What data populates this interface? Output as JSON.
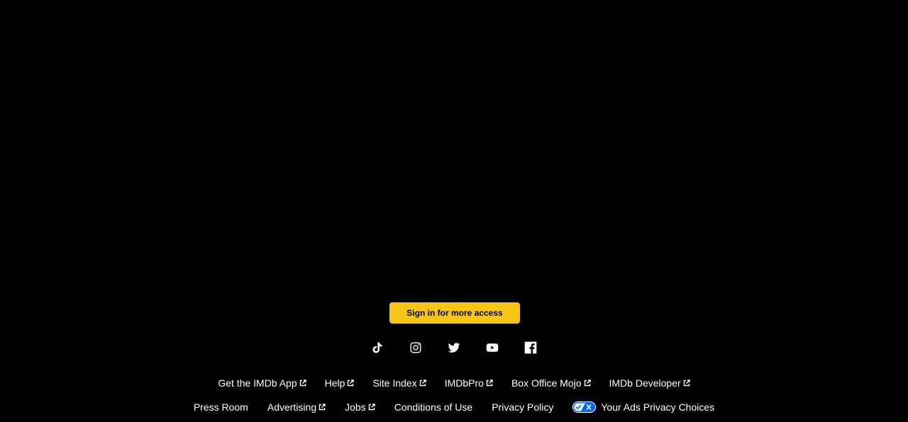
{
  "signin": {
    "label": "Sign in for more access"
  },
  "social": {
    "icons": [
      "tiktok-icon",
      "instagram-icon",
      "twitter-icon",
      "youtube-icon",
      "facebook-icon"
    ]
  },
  "footer": {
    "row1": [
      {
        "label": "Get the IMDb App",
        "external": true
      },
      {
        "label": "Help",
        "external": true
      },
      {
        "label": "Site Index",
        "external": true
      },
      {
        "label": "IMDbPro",
        "external": true
      },
      {
        "label": "Box Office Mojo",
        "external": true
      },
      {
        "label": "IMDb Developer",
        "external": true
      }
    ],
    "row2": [
      {
        "label": "Press Room",
        "external": false
      },
      {
        "label": "Advertising",
        "external": true
      },
      {
        "label": "Jobs",
        "external": true
      },
      {
        "label": "Conditions of Use",
        "external": false
      },
      {
        "label": "Privacy Policy",
        "external": false
      },
      {
        "label": "Your Ads Privacy Choices",
        "external": false
      }
    ]
  },
  "colors": {
    "background": "#000000",
    "accent": "#f5c518",
    "text": "#ffffff",
    "privacy_toggle": "#0066ff"
  }
}
